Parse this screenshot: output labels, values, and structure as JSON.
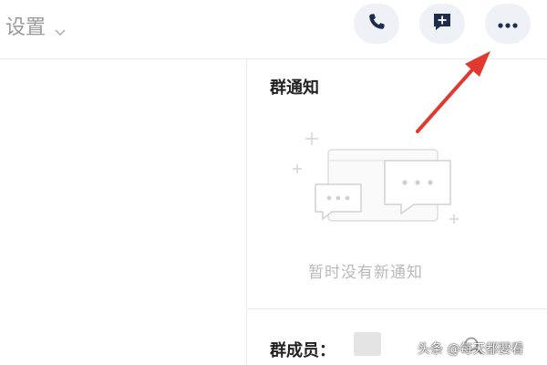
{
  "topbar": {
    "settings_label": "设置",
    "buttons": {
      "call": "phone-icon",
      "note": "add-note-icon",
      "more": "more-icon"
    }
  },
  "notice": {
    "title": "群通知",
    "empty_text": "暂时没有新通知"
  },
  "members": {
    "label": "群成员："
  },
  "watermark": "头条 @每天都要看",
  "colors": {
    "button_bg": "#eef1f6",
    "icon": "#1f2d4d",
    "arrow": "#e03a2f",
    "muted_text": "#b9b9b9"
  }
}
